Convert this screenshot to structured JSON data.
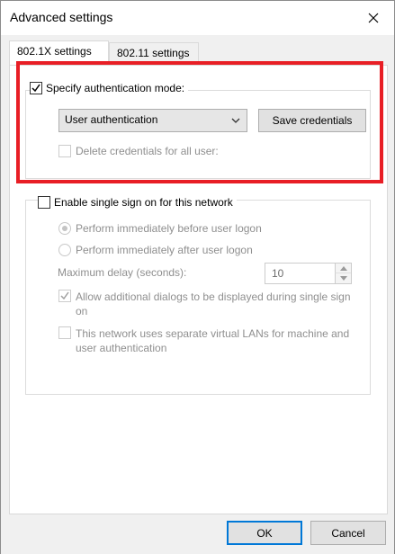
{
  "window": {
    "title": "Advanced settings"
  },
  "tabs": [
    {
      "label": "802.1X settings",
      "active": true
    },
    {
      "label": "802.11 settings",
      "active": false
    }
  ],
  "auth": {
    "specify_label": "Specify authentication mode:",
    "specify_checked": true,
    "mode_value": "User authentication",
    "save_credentials_label": "Save credentials",
    "delete_credentials_label": "Delete credentials for all user:",
    "delete_credentials_checked": false
  },
  "sso": {
    "enable_label": "Enable single sign on for this network",
    "enable_checked": false,
    "before_logon_label": "Perform immediately before user logon",
    "before_logon_selected": true,
    "after_logon_label": "Perform immediately after user logon",
    "max_delay_label": "Maximum delay (seconds):",
    "max_delay_value": "10",
    "additional_dialogs_label": "Allow additional dialogs to be displayed during single sign on",
    "additional_dialogs_checked": true,
    "separate_vlan_label": "This network uses separate virtual LANs for machine and user authentication",
    "separate_vlan_checked": false
  },
  "footer": {
    "ok_label": "OK",
    "cancel_label": "Cancel"
  },
  "colors": {
    "highlight": "#e81e25",
    "disabled_text": "#8f8f8f",
    "accent": "#0078d7"
  }
}
